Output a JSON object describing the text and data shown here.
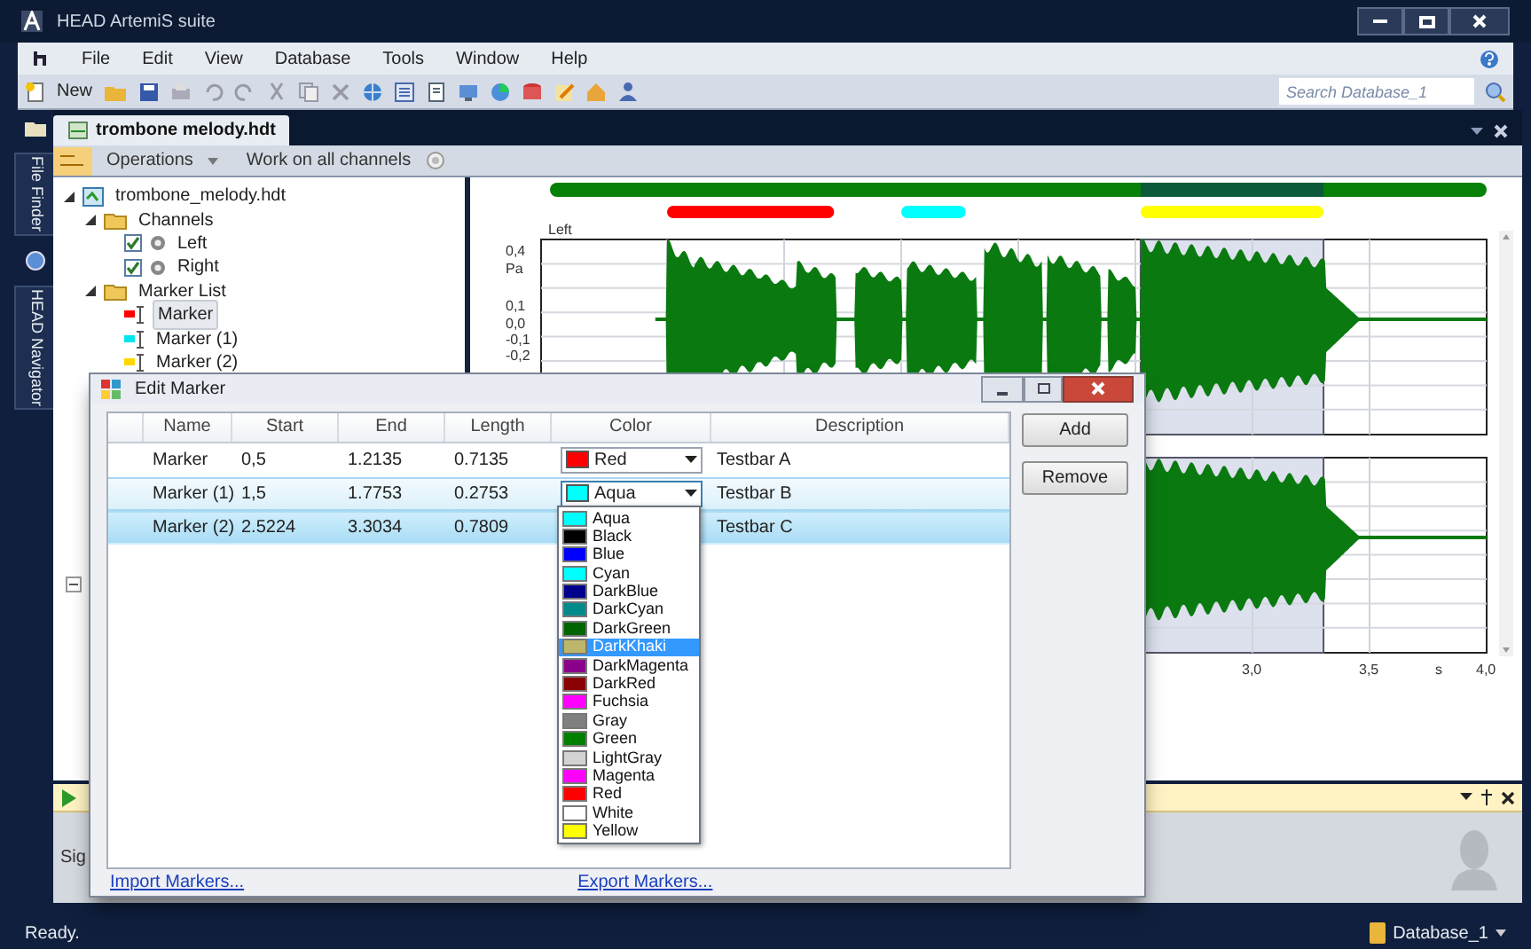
{
  "window": {
    "title": "HEAD ArtemiS suite"
  },
  "menu": [
    "File",
    "Edit",
    "View",
    "Database",
    "Tools",
    "Window",
    "Help"
  ],
  "toolbar": {
    "new_label": "New",
    "search": {
      "placeholder": "Search Database_1"
    }
  },
  "side_tabs": [
    {
      "label": "File Finder"
    },
    {
      "label": "HEAD Navigator"
    }
  ],
  "document_tab": {
    "label": "trombone melody.hdt",
    "selected": true
  },
  "operations_bar": {
    "operations": "Operations",
    "work_on": "Work on all channels"
  },
  "tree": [
    {
      "label": "trombone_melody.hdt",
      "kind": "file",
      "expanded": true,
      "children": [
        {
          "label": "Channels",
          "kind": "folder",
          "expanded": true,
          "children": [
            {
              "label": "Left",
              "kind": "channel",
              "checked": true
            },
            {
              "label": "Right",
              "kind": "channel",
              "checked": true
            }
          ]
        },
        {
          "label": "Marker List",
          "kind": "folder",
          "expanded": true,
          "children": [
            {
              "label": "Marker",
              "kind": "marker",
              "color": "#ff0000",
              "selected": true
            },
            {
              "label": "Marker (1)",
              "kind": "marker",
              "color": "#00e5ee",
              "selected": false
            },
            {
              "label": "Marker (2)",
              "kind": "marker",
              "color": "#ffd700",
              "selected": false
            }
          ]
        }
      ]
    }
  ],
  "waveform": {
    "channel_label": "Left",
    "y_labels": [
      "0,4",
      "Pa",
      "0,1",
      "0,0",
      "-0,1",
      "-0,2"
    ],
    "x_labels": [
      "3,0",
      "3,5",
      "s",
      "4,0"
    ]
  },
  "dialog": {
    "title": "Edit Marker",
    "columns": [
      "Name",
      "Start",
      "End",
      "Length",
      "Color",
      "Description"
    ],
    "rows": [
      {
        "name": "Marker",
        "start": "0,5",
        "end": "1.2135",
        "length": "0.7135",
        "color": "#ff0000",
        "color_name": "Red",
        "description": "Testbar A",
        "selected": false,
        "open": false
      },
      {
        "name": "Marker (1)",
        "start": "1,5",
        "end": "1.7753",
        "length": "0.2753",
        "color": "#00ffff",
        "color_name": "Aqua",
        "description": "Testbar B",
        "selected": false,
        "open": true
      },
      {
        "name": "Marker (2)",
        "start": "2.5224",
        "end": "3.3034",
        "length": "0.7809",
        "color": "#ffff00",
        "description": "Testbar C",
        "selected": true,
        "open": false
      }
    ],
    "color_options": [
      {
        "name": "Aqua",
        "color": "#00ffff",
        "selected": false
      },
      {
        "name": "Black",
        "color": "#000000",
        "selected": false
      },
      {
        "name": "Blue",
        "color": "#0000ff",
        "selected": false
      },
      {
        "name": "Cyan",
        "color": "#00ffff",
        "selected": false
      },
      {
        "name": "DarkBlue",
        "color": "#00008b",
        "selected": false
      },
      {
        "name": "DarkCyan",
        "color": "#008b8b",
        "selected": false
      },
      {
        "name": "DarkGreen",
        "color": "#006400",
        "selected": false
      },
      {
        "name": "DarkKhaki",
        "color": "#bdb76b",
        "selected": true
      },
      {
        "name": "DarkMagenta",
        "color": "#8b008b",
        "selected": false
      },
      {
        "name": "DarkRed",
        "color": "#8b0000",
        "selected": false
      },
      {
        "name": "Fuchsia",
        "color": "#ff00ff",
        "selected": false
      },
      {
        "name": "Gray",
        "color": "#808080",
        "selected": false
      },
      {
        "name": "Green",
        "color": "#008000",
        "selected": false
      },
      {
        "name": "LightGray",
        "color": "#d3d3d3",
        "selected": false
      },
      {
        "name": "Magenta",
        "color": "#ff00ff",
        "selected": false
      },
      {
        "name": "Red",
        "color": "#ff0000",
        "selected": false
      },
      {
        "name": "White",
        "color": "#ffffff",
        "selected": false
      },
      {
        "name": "Yellow",
        "color": "#ffff00",
        "selected": false
      }
    ],
    "buttons": [
      "Add",
      "Remove"
    ],
    "links": [
      "Import Markers...",
      "Export Markers..."
    ]
  },
  "dock": {
    "text": "Sig"
  },
  "status_bar": {
    "text": "Ready.",
    "database": "Database_1"
  }
}
